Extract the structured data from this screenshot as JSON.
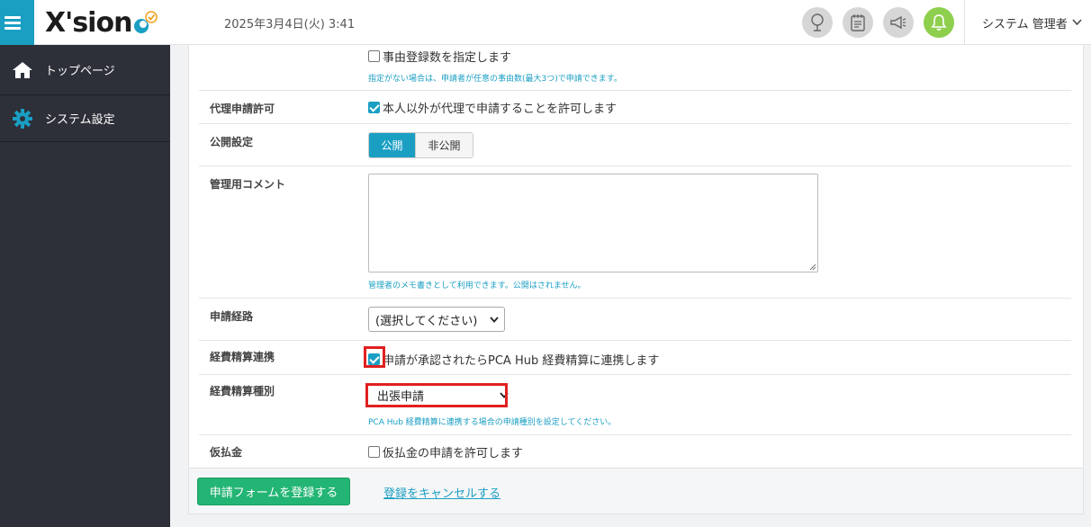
{
  "header": {
    "logo_text": "X'sion",
    "datetime": "2025年3月4日(火) 3:41",
    "user_name": "システム 管理者",
    "icons": [
      "webinar-icon",
      "notes-icon",
      "megaphone-icon",
      "bell-icon"
    ],
    "accent_color": "#1a9fc3",
    "bell_color": "#8ecf4e"
  },
  "sidebar": {
    "items": [
      {
        "label": "トップページ",
        "icon": "home-icon"
      },
      {
        "label": "システム設定",
        "icon": "gear-icon"
      }
    ]
  },
  "form": {
    "reason_count": {
      "label": "事由登録数を指定します",
      "checked": false,
      "help": "指定がない場合は、申請者が任意の事由数(最大3つ)で申請できます。"
    },
    "proxy": {
      "label": "代理申請許可",
      "checkbox_label": "本人以外が代理で申請することを許可します",
      "checked": true
    },
    "publish": {
      "label": "公開設定",
      "options": [
        "公開",
        "非公開"
      ],
      "selected": "公開"
    },
    "comment": {
      "label": "管理用コメント",
      "value": "",
      "help": "管理者のメモ書きとして利用できます。公開はされません。"
    },
    "route": {
      "label": "申請経路",
      "selected": "(選択してください)"
    },
    "expense_link": {
      "label": "経費精算連携",
      "checkbox_label": "申請が承認されたらPCA Hub 経費精算に連携します",
      "checked": true
    },
    "expense_type": {
      "label": "経費精算種別",
      "selected": "出張申請",
      "help": "PCA Hub 経費精算に連携する場合の申請種別を設定してください。"
    },
    "advance": {
      "label": "仮払金",
      "checkbox_label": "仮払金の申請を許可します",
      "checked": false
    }
  },
  "footer": {
    "submit_label": "申請フォームを登録する",
    "cancel_label": "登録をキャンセルする"
  },
  "highlight_color": "#e02020"
}
